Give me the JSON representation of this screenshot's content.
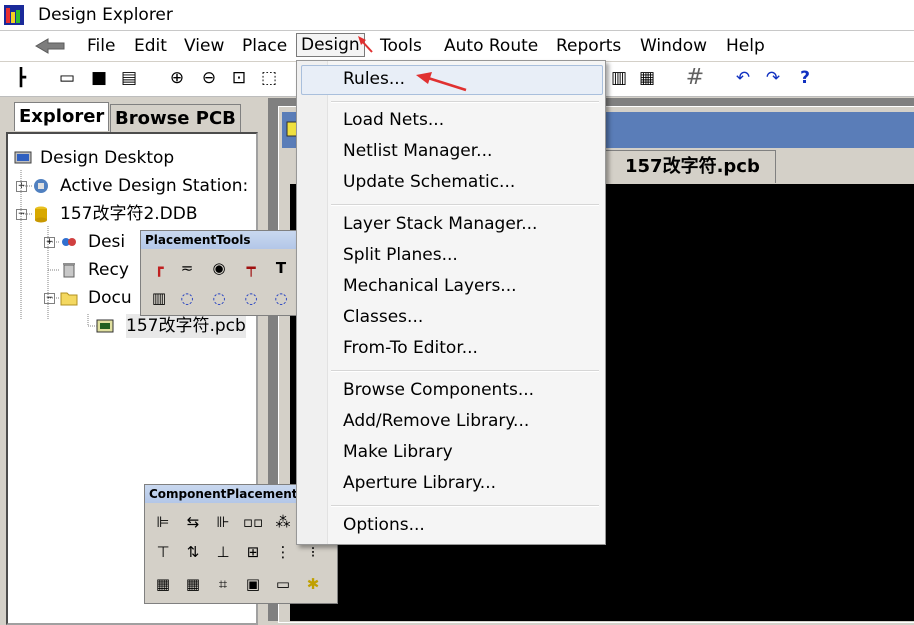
{
  "window": {
    "title": "Design Explorer"
  },
  "menubar": {
    "items": [
      "File",
      "Edit",
      "View",
      "Place",
      "Design",
      "Tools",
      "Auto Route",
      "Reports",
      "Window",
      "Help"
    ]
  },
  "explorer": {
    "tabs": [
      "Explorer",
      "Browse PCB"
    ],
    "tree": [
      {
        "label": "Design Desktop",
        "level": 0
      },
      {
        "label": "Active Design Station:",
        "level": 1
      },
      {
        "label": "157改字符2.DDB",
        "level": 1
      },
      {
        "label": "Desi",
        "level": 2
      },
      {
        "label": "Recy",
        "level": 2
      },
      {
        "label": "Docu",
        "level": 2
      },
      {
        "label": "157改字符.pcb",
        "level": 3
      }
    ]
  },
  "document": {
    "tab_label": "157改字符.pcb"
  },
  "design_menu": {
    "groups": [
      [
        "Rules..."
      ],
      [
        "Load Nets...",
        "Netlist Manager...",
        "Update Schematic..."
      ],
      [
        "Layer Stack Manager...",
        "Split Planes...",
        "Mechanical Layers...",
        "Classes...",
        "From-To Editor..."
      ],
      [
        "Browse Components...",
        "Add/Remove Library...",
        "Make Library",
        "Aperture Library..."
      ],
      [
        "Options..."
      ]
    ],
    "highlighted": "Rules..."
  },
  "placement_tools": {
    "title": "PlacementTools"
  },
  "component_placement": {
    "title": "ComponentPlacement"
  },
  "colors": {
    "arrow": "#e03030",
    "canvas": "#000000",
    "highlight": "#e8eef7"
  }
}
